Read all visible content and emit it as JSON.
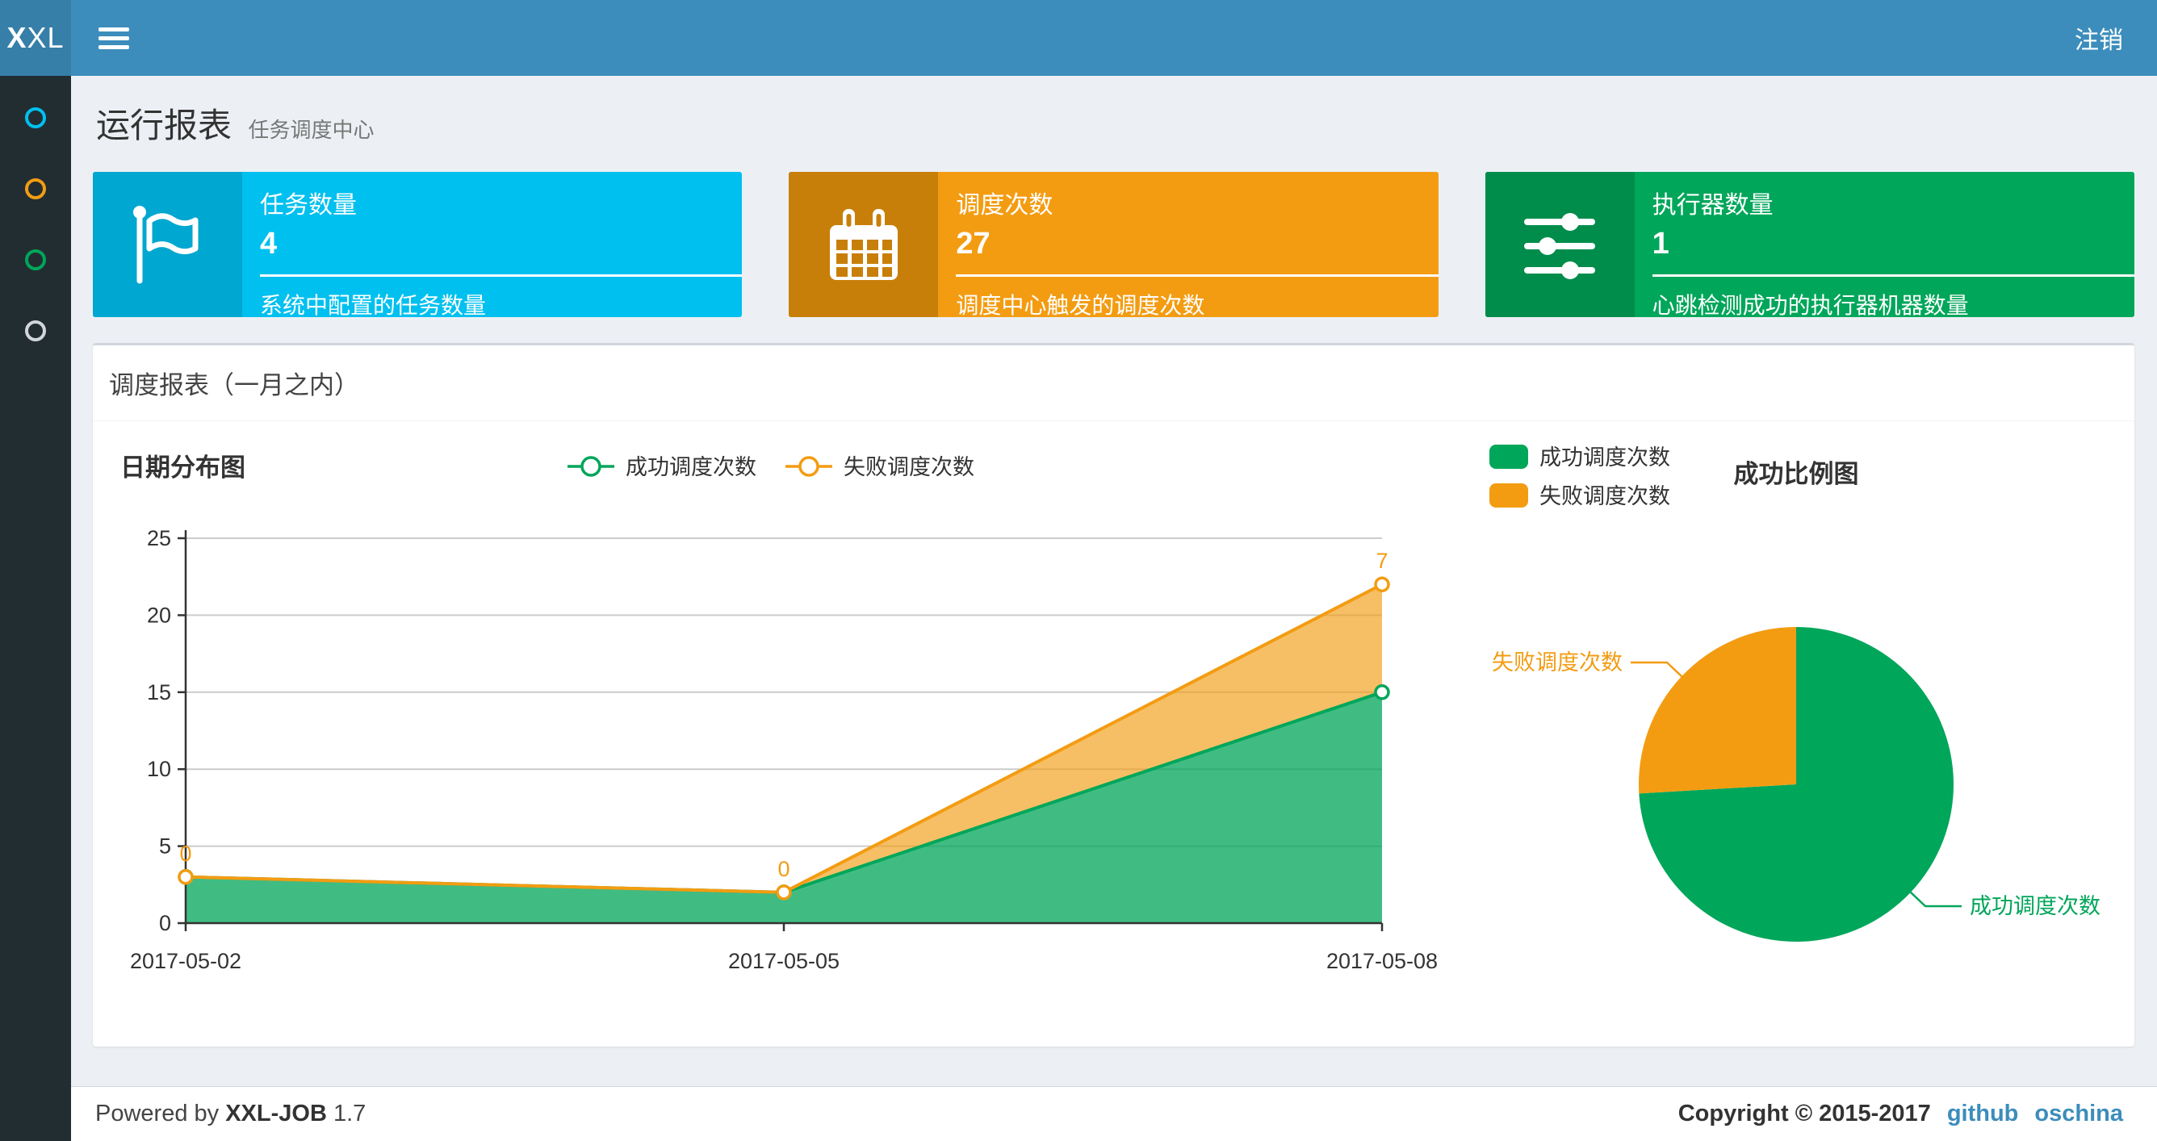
{
  "header": {
    "logo_bold": "X",
    "logo_rest": "XL",
    "logout_label": "注销",
    "bg": "#3c8dbc",
    "logo_bg": "#367fa9"
  },
  "sidebar": {
    "bg": "#222d32",
    "items": [
      {
        "name": "menu-item-1",
        "color": "#00c0ef"
      },
      {
        "name": "menu-item-2",
        "color": "#f39c12"
      },
      {
        "name": "menu-item-3",
        "color": "#00a65a"
      },
      {
        "name": "menu-item-4",
        "color": "#d2d6de"
      }
    ]
  },
  "page": {
    "title": "运行报表",
    "subtitle": "任务调度中心"
  },
  "cards": [
    {
      "title": "任务数量",
      "value": "4",
      "desc": "系统中配置的任务数量",
      "bg": "#00c0ef",
      "icon_bg": "#00a7d0",
      "icon": "flag-icon"
    },
    {
      "title": "调度次数",
      "value": "27",
      "desc": "调度中心触发的调度次数",
      "bg": "#f39c12",
      "icon_bg": "#c87f0a",
      "icon": "calendar-icon"
    },
    {
      "title": "执行器数量",
      "value": "1",
      "desc": "心跳检测成功的执行器机器数量",
      "bg": "#00a65a",
      "icon_bg": "#008d4c",
      "icon": "sliders-icon"
    }
  ],
  "panel": {
    "title": "调度报表（一月之内）"
  },
  "chart_data": [
    {
      "type": "area",
      "title": "日期分布图",
      "x": [
        "2017-05-02",
        "2017-05-05",
        "2017-05-08"
      ],
      "series": [
        {
          "name": "成功调度次数",
          "values": [
            3,
            2,
            15
          ],
          "color": "#00a65a",
          "fill": "rgba(0,166,90,0.75)"
        },
        {
          "name": "失败调度次数",
          "values": [
            0,
            0,
            7
          ],
          "color": "#f39c12",
          "fill": "rgba(243,156,18,0.65)"
        }
      ],
      "stacked": true,
      "ylim": [
        0,
        25
      ],
      "yticks": [
        0,
        5,
        10,
        15,
        20,
        25
      ],
      "grid": true,
      "legend_position": "top-center",
      "data_labels": {
        "series": "失败调度次数",
        "values": [
          0,
          0,
          7
        ]
      }
    },
    {
      "type": "pie",
      "title": "成功比例图",
      "slices": [
        {
          "name": "成功调度次数",
          "value": 20,
          "color": "#00a65a"
        },
        {
          "name": "失败调度次数",
          "value": 7,
          "color": "#f39c12"
        }
      ],
      "legend_position": "top-left",
      "start_angle_deg": 90,
      "clockwise": true
    }
  ],
  "footer": {
    "powered_prefix": "Powered by",
    "product": "XXL-JOB",
    "version": "1.7",
    "copyright": "Copyright © 2015-2017",
    "links": [
      {
        "label": "github"
      },
      {
        "label": "oschina"
      }
    ],
    "link_color": "#3c8dbc"
  }
}
